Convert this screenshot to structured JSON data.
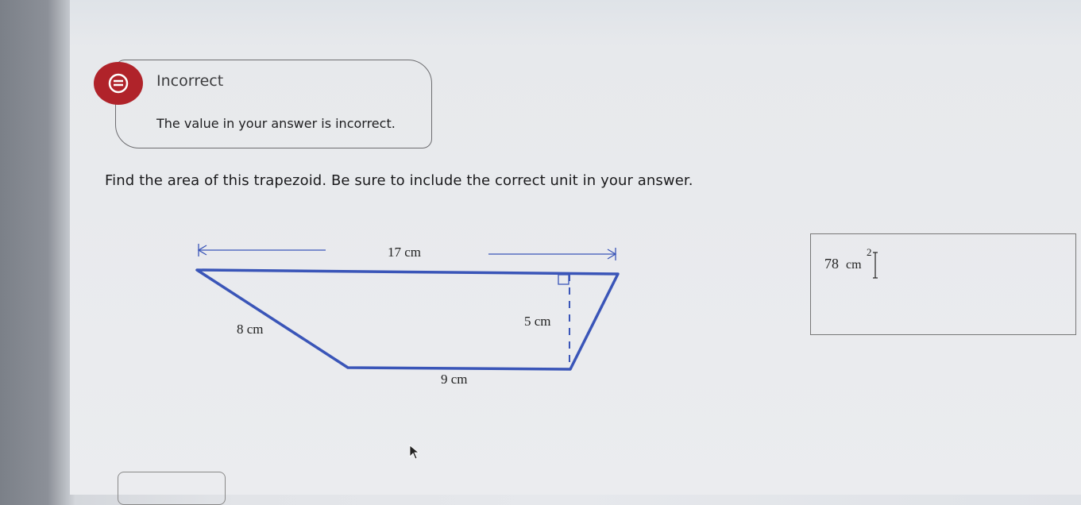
{
  "feedback": {
    "title": "Incorrect",
    "message": "The value in your answer is incorrect.",
    "icon": "incorrect-icon",
    "color": "#b0232a"
  },
  "question": {
    "text": "Find the area of this trapezoid. Be sure to include the correct unit in your answer."
  },
  "figure": {
    "top_base": "17 cm",
    "height": "5 cm",
    "slant_side": "8 cm",
    "bottom_base": "9 cm",
    "line_color": "#3a55b8"
  },
  "answer": {
    "value": "78",
    "unit": "cm",
    "exponent": "2"
  }
}
